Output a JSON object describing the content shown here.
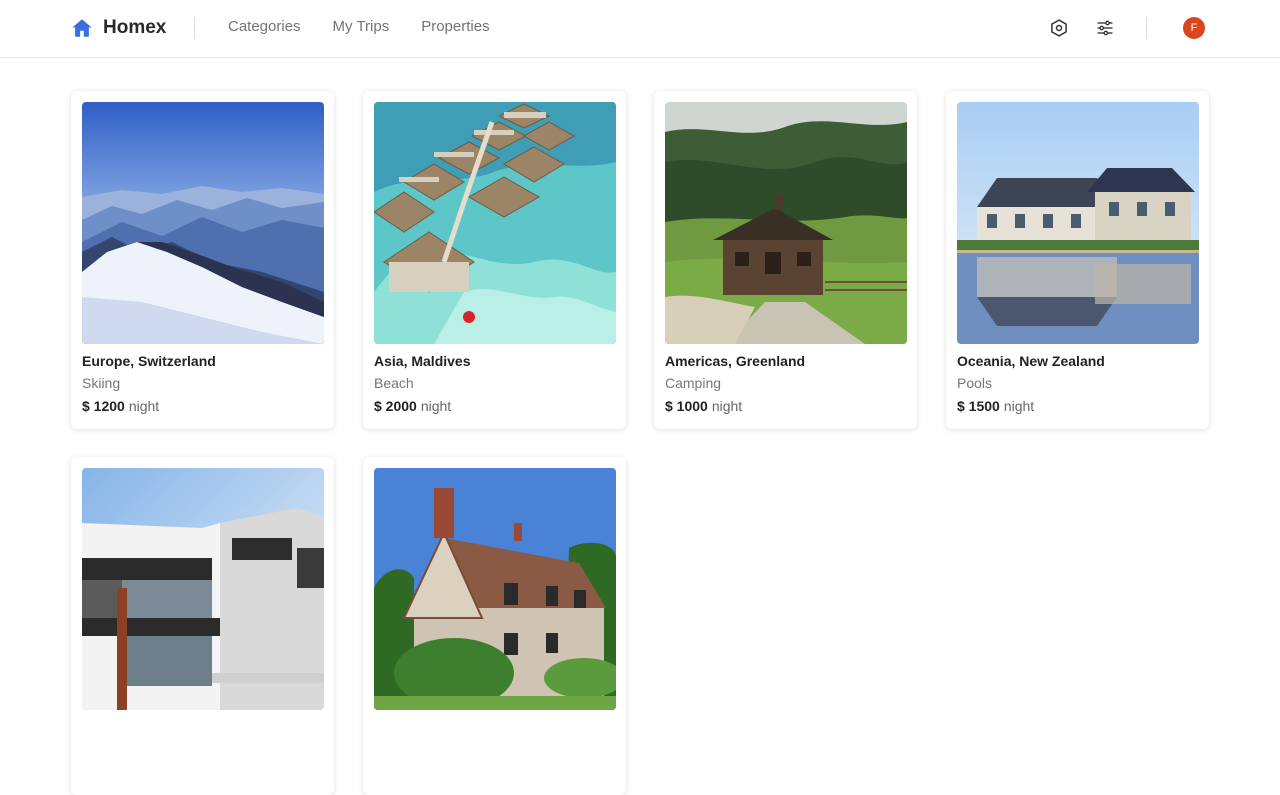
{
  "app": {
    "name": "Homex",
    "accent": "#3b6fe0",
    "avatar_initial": "F",
    "avatar_color": "#d9461f"
  },
  "nav": {
    "links": [
      "Categories",
      "My Trips",
      "Properties"
    ]
  },
  "listings": [
    {
      "place": "Europe, Switzerland",
      "category": "Skiing",
      "price": "$ 1200",
      "unit": "night",
      "image": "snowy-mountains"
    },
    {
      "place": "Asia, Maldives",
      "category": "Beach",
      "price": "$ 2000",
      "unit": "night",
      "image": "overwater-bungalows"
    },
    {
      "place": "Americas, Greenland",
      "category": "Camping",
      "price": "$ 1000",
      "unit": "night",
      "image": "wooden-cabin"
    },
    {
      "place": "Oceania, New Zealand",
      "category": "Pools",
      "price": "$ 1500",
      "unit": "night",
      "image": "lakeside-house"
    },
    {
      "place": "",
      "category": "",
      "price": "",
      "unit": "",
      "image": "modern-building"
    },
    {
      "place": "",
      "category": "",
      "price": "",
      "unit": "",
      "image": "brick-cottage"
    }
  ]
}
